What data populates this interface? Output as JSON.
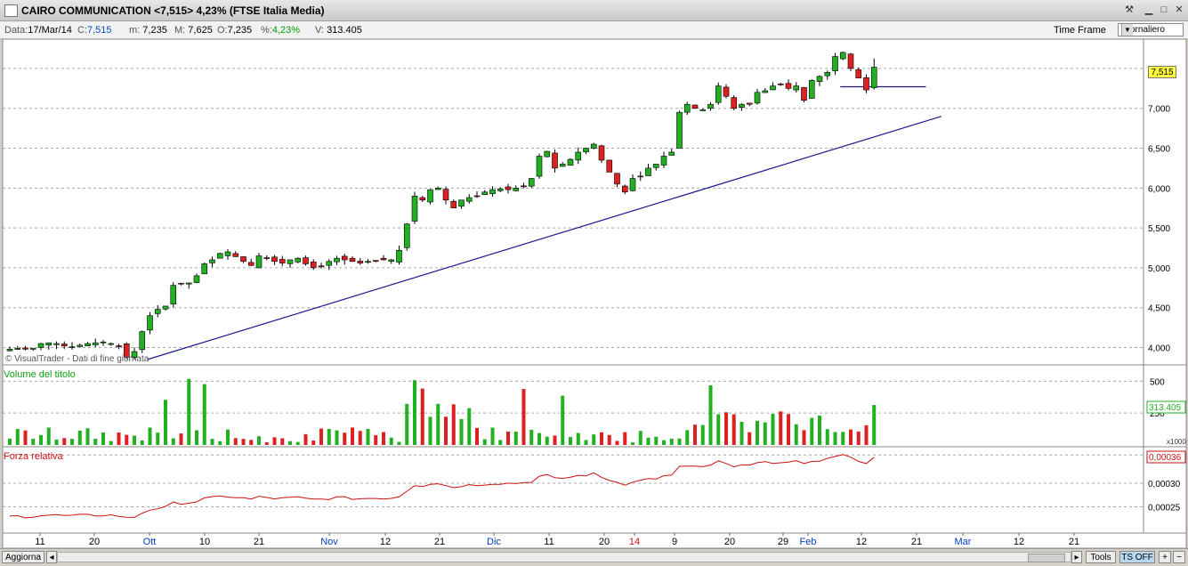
{
  "window": {
    "title": "CAIRO COMMUNICATION <7,515> 4,23%  (FTSE Italia Media)"
  },
  "info": {
    "data_label": "Data:",
    "data_value": "17/Mar/14",
    "c_label": "C:",
    "c_value": "7,515",
    "m_label": "m:",
    "m_value": "7,235",
    "M_label": "M:",
    "M_value": "7,625",
    "o_label": "O:",
    "o_value": "7,235",
    "pct_label": "%:",
    "pct_value": "4,23%",
    "v_label": "V:",
    "v_value": "313.405",
    "timeframe_label": "Time Frame",
    "timeframe_value": "Giornaliero"
  },
  "price_panel": {
    "watermark": "© VisualTrader - Dati di fine giornata",
    "last_price": "7,515",
    "y_ticks": [
      "7,000",
      "6,500",
      "6,000",
      "5,500",
      "5,000",
      "4,500",
      "4,000"
    ]
  },
  "volume_panel": {
    "title": "Volume del titolo",
    "last_value": "313.405",
    "y_ticks": [
      "500",
      "250"
    ],
    "multiplier": "x1000"
  },
  "rs_panel": {
    "title": "Forza relativa",
    "last_value": "0,00036",
    "y_ticks": [
      "0,00030",
      "0,00025"
    ]
  },
  "x_axis": {
    "labels": [
      "11",
      "20",
      "Ott",
      "10",
      "21",
      "Nov",
      "12",
      "21",
      "Dic",
      "11",
      "20",
      "14",
      "9",
      "20",
      "29",
      "Feb",
      "12",
      "21",
      "Mar",
      "12",
      "21"
    ]
  },
  "bottom": {
    "aggiorna": "Aggiorna",
    "tools": "Tools",
    "ts_off": "TS OFF",
    "plus": "+",
    "minus": "−"
  },
  "colors": {
    "up": "#22b022",
    "down": "#dd2020",
    "trendline": "#1a1a8c",
    "volume_label": "#10a010",
    "rs_line": "#cc1010"
  },
  "chart_data": {
    "type": "candlestick",
    "period": "daily",
    "date_range": [
      "2013-09-05",
      "2014-03-17"
    ],
    "ylim": [
      3.85,
      7.8
    ],
    "closes_approx": [
      3.98,
      3.99,
      3.98,
      3.99,
      4.05,
      4.06,
      4.05,
      4.02,
      4.01,
      4.03,
      4.05,
      4.06,
      4.07,
      4.05,
      4.02,
      3.88,
      3.95,
      4.2,
      4.4,
      4.48,
      4.52,
      4.78,
      4.8,
      4.81,
      4.9,
      5.05,
      5.1,
      5.18,
      5.2,
      5.14,
      5.08,
      5.03,
      5.15,
      5.12,
      5.08,
      5.06,
      5.1,
      5.12,
      5.05,
      5.0,
      5.02,
      5.08,
      5.12,
      5.1,
      5.08,
      5.06,
      5.08,
      5.09,
      5.1,
      5.1,
      5.22,
      5.55,
      5.9,
      5.85,
      5.98,
      6.0,
      5.85,
      5.75,
      5.85,
      5.88,
      5.9,
      5.95,
      5.98,
      5.99,
      5.98,
      6.0,
      6.02,
      6.12,
      6.4,
      6.46,
      6.25,
      6.3,
      6.36,
      6.45,
      6.5,
      6.55,
      6.35,
      6.2,
      6.05,
      5.95,
      6.12,
      6.15,
      6.25,
      6.3,
      6.4,
      6.45,
      6.95,
      7.05,
      7.0,
      6.98,
      7.05,
      7.28,
      7.15,
      7.0,
      7.05,
      7.05,
      7.2,
      7.22,
      7.28,
      7.3,
      7.25,
      7.28,
      7.1,
      7.35,
      7.4,
      7.45,
      7.65,
      7.7,
      7.5,
      7.38,
      7.23,
      7.515
    ],
    "volume_k": {
      "last": 313.405,
      "max_approx": 550
    },
    "relative_strength": {
      "last": 0.00036,
      "min_approx": 0.000225
    },
    "trendline": {
      "from": [
        "2013-10-01",
        3.85
      ],
      "to": [
        "2014-03-24",
        6.9
      ]
    }
  }
}
